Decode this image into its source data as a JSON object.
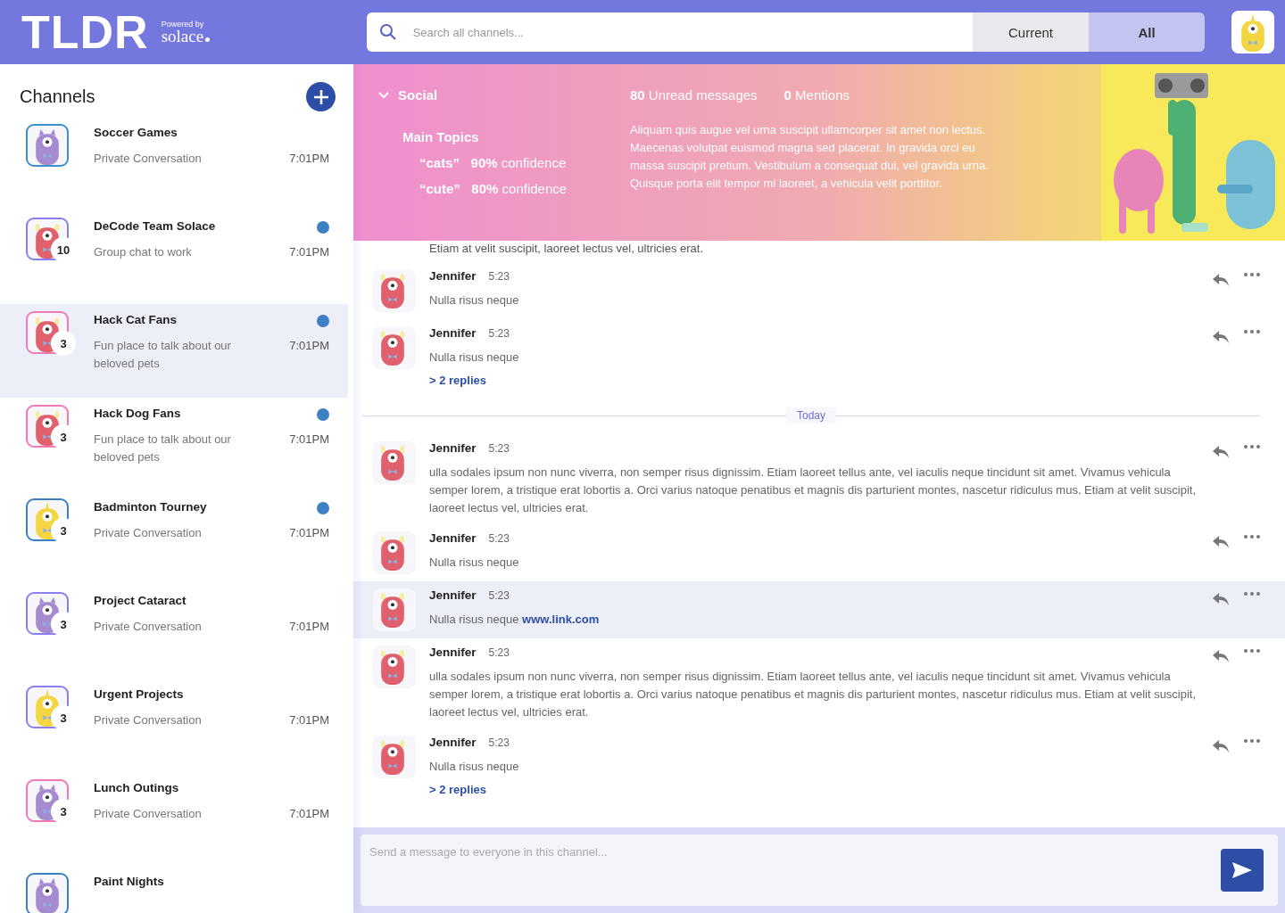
{
  "header": {
    "logo": "TLDR",
    "powered_by": "Powered by",
    "brand": "solace"
  },
  "search": {
    "placeholder": "Search all channels...",
    "scopes": [
      {
        "label": "Current",
        "selected": false
      },
      {
        "label": "All",
        "selected": true
      }
    ]
  },
  "sidebar": {
    "title": "Channels",
    "channels": [
      {
        "name": "Soccer Games",
        "subtitle": "Private Conversation",
        "time": "7:01PM",
        "kind": "purple",
        "color": "#3b8fd0",
        "unread": false,
        "selected": false
      },
      {
        "name": "DeCode Team Solace",
        "subtitle": "Group chat to work",
        "time": "7:01PM",
        "kind": "red",
        "color": "#8a7ff0",
        "badge": "10",
        "unread": true,
        "selected": false
      },
      {
        "name": "Hack Cat Fans",
        "subtitle": "Fun place to talk about our beloved pets",
        "time": "7:01PM",
        "kind": "red",
        "color": "#f07ab8",
        "badge": "3",
        "unread": true,
        "selected": true
      },
      {
        "name": "Hack Dog Fans",
        "subtitle": "Fun place to talk about our beloved pets",
        "time": "7:01PM",
        "kind": "red",
        "color": "#f07ab8",
        "badge": "3",
        "unread": true,
        "selected": false
      },
      {
        "name": "Badminton Tourney",
        "subtitle": "Private Conversation",
        "time": "7:01PM",
        "kind": "yellow",
        "color": "#3b7fc4",
        "badge": "3",
        "unread": true,
        "selected": false
      },
      {
        "name": "Project Cataract",
        "subtitle": "Private Conversation",
        "time": "7:01PM",
        "kind": "purple",
        "color": "#8a7ff0",
        "badge": "3",
        "unread": false,
        "selected": false
      },
      {
        "name": "Urgent Projects",
        "subtitle": "Private Conversation",
        "time": "7:01PM",
        "kind": "yellow",
        "color": "#8a7ff0",
        "badge": "3",
        "unread": false,
        "selected": false
      },
      {
        "name": "Lunch Outings",
        "subtitle": "Private Conversation",
        "time": "7:01PM",
        "kind": "purple",
        "color": "#f07ab8",
        "badge": "3",
        "unread": false,
        "selected": false
      },
      {
        "name": "Paint Nights",
        "kind": "purple",
        "color": "#3b7fc4",
        "unread": false,
        "selected": false
      }
    ]
  },
  "summary": {
    "channel": "Social",
    "expanded": true,
    "unread_count": "80",
    "unread_label": "Unread messages",
    "mentions_count": "0",
    "mentions_label": "Mentions",
    "topics_title": "Main Topics",
    "topics": [
      {
        "term": "“cats”",
        "percent": "90%",
        "label": "confidence"
      },
      {
        "term": "“cute”",
        "percent": "80%",
        "label": "confidence"
      }
    ],
    "description": "Aliquam quis augue vel urna suscipit ullamcorper sit amet non lectus. Maecenas volutpat euismod magna sed placerat. In gravida orci eu massa suscipit pretium. Vestibulum a consequat dui, vel gravida urna. Quisque porta elit tempor mi laoreet, a vehicula velit porttitor."
  },
  "messages": [
    {
      "kind": "fragment",
      "text": "Etiam at velit suscipit, laoreet lectus vel, ultricies erat."
    },
    {
      "kind": "message",
      "author": "Jennifer",
      "time": "5:23",
      "text": "Nulla risus neque",
      "hovered": false
    },
    {
      "kind": "message",
      "author": "Jennifer",
      "time": "5:23",
      "text": "Nulla risus neque",
      "replies": "> 2 replies",
      "hovered": false
    },
    {
      "kind": "divider",
      "label": "Today"
    },
    {
      "kind": "message",
      "author": "Jennifer",
      "time": "5:23",
      "text": "ulla sodales ipsum non nunc viverra, non semper risus dignissim. Etiam laoreet tellus ante, vel iaculis neque tincidunt sit amet. Vivamus vehicula semper lorem, a tristique erat lobortis a. Orci varius natoque penatibus et magnis dis parturient montes, nascetur ridiculus mus. Etiam at velit suscipit, laoreet lectus vel, ultricies erat.",
      "hovered": false
    },
    {
      "kind": "message",
      "author": "Jennifer",
      "time": "5:23",
      "text": "Nulla risus neque",
      "hovered": false
    },
    {
      "kind": "message",
      "author": "Jennifer",
      "time": "5:23",
      "text": "Nulla risus neque",
      "link": "www.link.com",
      "hovered": true
    },
    {
      "kind": "message",
      "author": "Jennifer",
      "time": "5:23",
      "text": "ulla sodales ipsum non nunc viverra, non semper risus dignissim. Etiam laoreet tellus ante, vel iaculis neque tincidunt sit amet. Vivamus vehicula semper lorem, a tristique erat lobortis a. Orci varius natoque penatibus et magnis dis parturient montes, nascetur ridiculus mus. Etiam at velit suscipit, laoreet lectus vel, ultricies erat.",
      "hovered": false
    },
    {
      "kind": "message",
      "author": "Jennifer",
      "time": "5:23",
      "text": "Nulla risus neque",
      "replies": "> 2 replies",
      "hovered": false
    }
  ],
  "composer": {
    "placeholder": "Send a message to everyone in this channel..."
  }
}
